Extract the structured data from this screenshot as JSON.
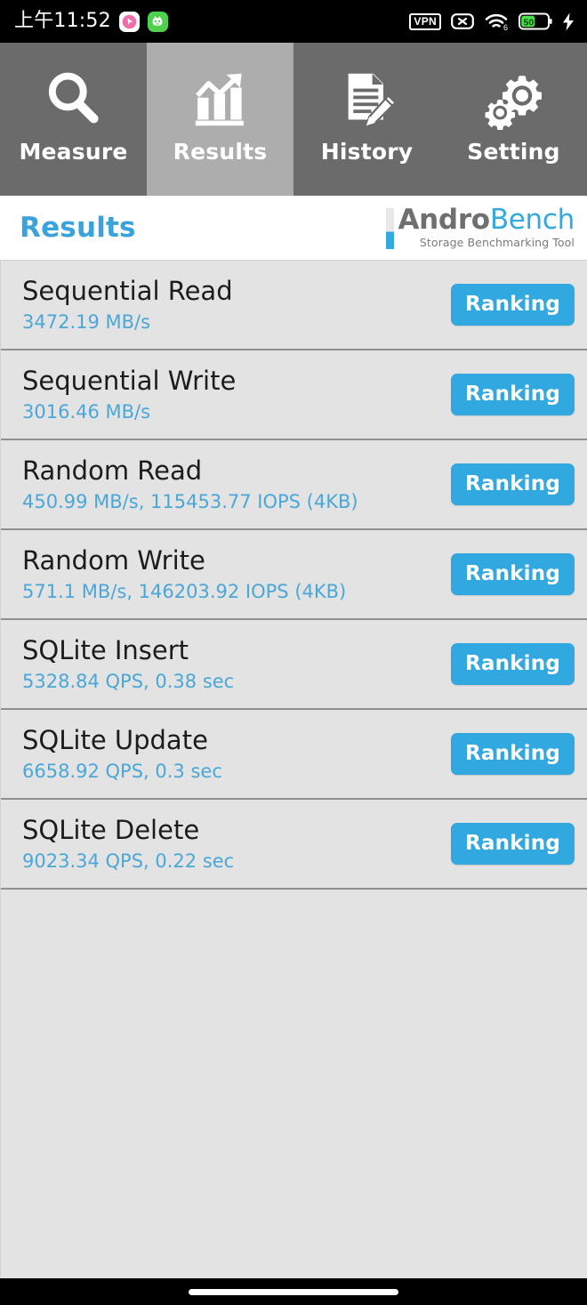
{
  "status_bar": {
    "clock": "上午11:52",
    "notification_icons": [
      "cursor-app-icon",
      "face-app-icon"
    ],
    "vpn_label": "VPN",
    "icons": [
      "vpn-icon",
      "mute-icon",
      "wifi-6-icon",
      "battery-icon",
      "charging-bolt-icon"
    ],
    "battery_percent": "50",
    "wifi_generation": "6"
  },
  "tabs": [
    {
      "label": "Measure",
      "icon": "magnifier-icon",
      "active": false
    },
    {
      "label": "Results",
      "icon": "bar-chart-arrow-icon",
      "active": true
    },
    {
      "label": "History",
      "icon": "document-pencil-icon",
      "active": false
    },
    {
      "label": "Setting",
      "icon": "gears-icon",
      "active": false
    }
  ],
  "header": {
    "title": "Results",
    "logo_primary": "Andro",
    "logo_secondary": "Bench",
    "logo_subtitle": "Storage Benchmarking Tool"
  },
  "results": {
    "button_label": "Ranking",
    "rows": [
      {
        "title": "Sequential Read",
        "value": "3472.19 MB/s"
      },
      {
        "title": "Sequential Write",
        "value": "3016.46 MB/s"
      },
      {
        "title": "Random Read",
        "value": "450.99 MB/s, 115453.77 IOPS (4KB)"
      },
      {
        "title": "Random Write",
        "value": "571.1 MB/s, 146203.92 IOPS (4KB)"
      },
      {
        "title": "SQLite Insert",
        "value": "5328.84 QPS, 0.38 sec"
      },
      {
        "title": "SQLite Update",
        "value": "6658.92 QPS, 0.3 sec"
      },
      {
        "title": "SQLite Delete",
        "value": "9023.34 QPS, 0.22 sec"
      }
    ]
  },
  "colors": {
    "accent_blue": "#32a8e0",
    "value_blue": "#4aa7d8",
    "tab_inactive": "#6b6b6b",
    "tab_active": "#adadad",
    "row_background": "#e3e3e3"
  },
  "nav_bar": {
    "home_indicator": "home-indicator-pill"
  }
}
